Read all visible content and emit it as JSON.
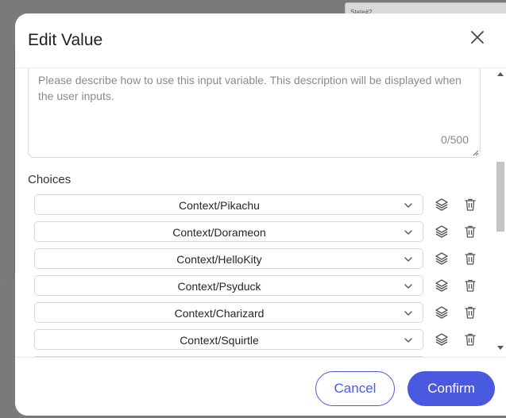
{
  "backdrop": {
    "card_label": "State#2"
  },
  "dialog": {
    "title": "Edit Value",
    "close_icon": "close-icon"
  },
  "description": {
    "placeholder": "Please describe how to use this input variable. This description will be displayed when the user inputs.",
    "value": "",
    "counter": "0/500"
  },
  "choices": {
    "label": "Choices",
    "items": [
      {
        "value": "Context/Pikachu"
      },
      {
        "value": "Context/Dorameon"
      },
      {
        "value": "Context/HelloKity"
      },
      {
        "value": "Context/Psyduck"
      },
      {
        "value": "Context/Charizard"
      },
      {
        "value": "Context/Squirtle"
      }
    ],
    "item_icons": [
      "chevron-down-icon",
      "layers-icon",
      "trash-icon"
    ]
  },
  "footer": {
    "cancel_label": "Cancel",
    "confirm_label": "Confirm"
  },
  "colors": {
    "accent": "#4a5ae0",
    "overlay": "#7a7a7a"
  }
}
